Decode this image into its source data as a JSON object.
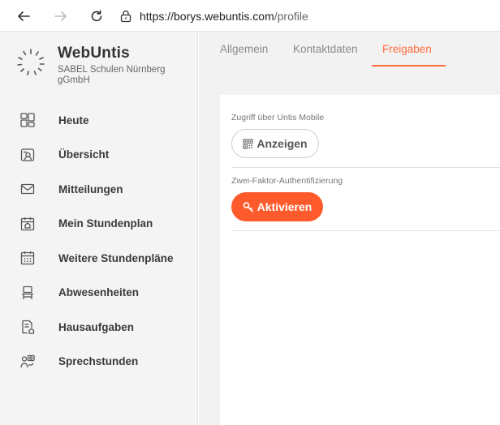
{
  "browser": {
    "url_host": "https://borys.webuntis.com",
    "url_path": "/profile",
    "icons": [
      "back-arrow-icon",
      "forward-arrow-icon",
      "reload-icon",
      "site-info-icon"
    ]
  },
  "brand": {
    "name": "WebUntis",
    "school": "SABEL Schulen Nürnberg gGmbH"
  },
  "sidebar": {
    "items": [
      {
        "label": "Heute",
        "icon": "dashboard-icon"
      },
      {
        "label": "Übersicht",
        "icon": "overview-icon"
      },
      {
        "label": "Mitteilungen",
        "icon": "mail-icon"
      },
      {
        "label": "Mein Stundenplan",
        "icon": "calendar-home-icon"
      },
      {
        "label": "Weitere Stundenpläne",
        "icon": "calendar-grid-icon"
      },
      {
        "label": "Abwesenheiten",
        "icon": "absence-icon"
      },
      {
        "label": "Hausaufgaben",
        "icon": "homework-icon"
      },
      {
        "label": "Sprechstunden",
        "icon": "consultation-icon"
      }
    ]
  },
  "tabs": [
    {
      "label": "Allgemein",
      "active": false
    },
    {
      "label": "Kontaktdaten",
      "active": false
    },
    {
      "label": "Freigaben",
      "active": true
    }
  ],
  "content": {
    "mobile_access_label": "Zugriff über Untis Mobile",
    "show_button_label": "Anzeigen",
    "two_factor_label": "Zwei-Faktor-Authentifizierung",
    "activate_button_label": "Aktivieren"
  },
  "colors": {
    "accent": "#ff6a3d",
    "primary_button": "#ff5a2c",
    "sidebar_bg": "#f4f4f4"
  }
}
